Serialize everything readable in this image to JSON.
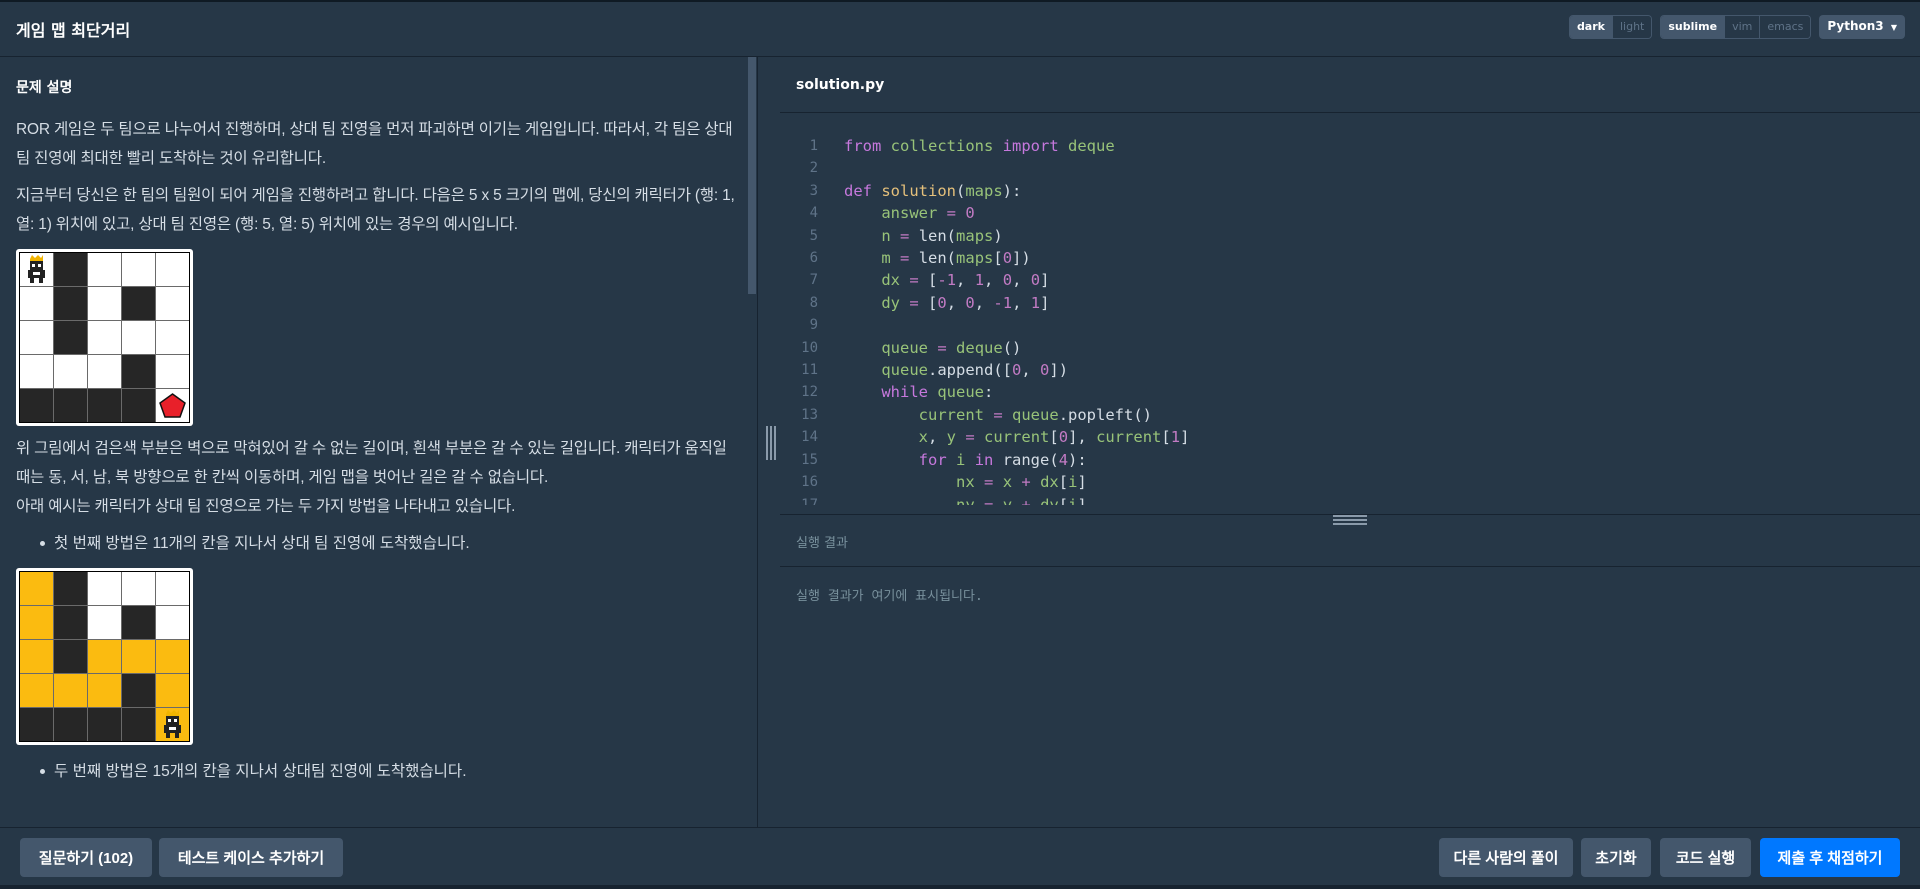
{
  "header": {
    "title": "게임 맵 최단거리",
    "theme_options": [
      "dark",
      "light"
    ],
    "theme_selected": "dark",
    "keymap_options": [
      "sublime",
      "vim",
      "emacs"
    ],
    "keymap_selected": "sublime",
    "language": "Python3"
  },
  "description": {
    "heading": "문제 설명",
    "para1": "ROR 게임은 두 팀으로 나누어서 진행하며, 상대 팀 진영을 먼저 파괴하면 이기는 게임입니다. 따라서, 각 팀은 상대 팀 진영에 최대한 빨리 도착하는 것이 유리합니다.",
    "para2": "지금부터 당신은 한 팀의 팀원이 되어 게임을 진행하려고 합니다. 다음은 5 x 5 크기의 맵에, 당신의 캐릭터가 (행: 1, 열: 1) 위치에 있고, 상대 팀 진영은 (행: 5, 열: 5) 위치에 있는 경우의 예시입니다.",
    "para3": "위 그림에서 검은색 부분은 벽으로 막혀있어 갈 수 없는 길이며, 흰색 부분은 갈 수 있는 길입니다. 캐릭터가 움직일 때는 동, 서, 남, 북 방향으로 한 칸씩 이동하며, 게임 맵을 벗어난 길은 갈 수 없습니다.",
    "para4": "아래 예시는 캐릭터가 상대 팀 진영으로 가는 두 가지 방법을 나타내고 있습니다.",
    "bullet1": "첫 번째 방법은 11개의 칸을 지나서 상대 팀 진영에 도착했습니다.",
    "bullet2": "두 번째 방법은 15개의 칸을 지나서 상대팀 진영에 도착했습니다.",
    "map1": [
      [
        "char",
        "b",
        "w",
        "w",
        "w"
      ],
      [
        "w",
        "b",
        "w",
        "b",
        "w"
      ],
      [
        "w",
        "b",
        "w",
        "w",
        "w"
      ],
      [
        "w",
        "w",
        "w",
        "b",
        "w"
      ],
      [
        "b",
        "b",
        "b",
        "b",
        "goal"
      ]
    ],
    "map2": [
      [
        "y",
        "b",
        "w",
        "w",
        "w"
      ],
      [
        "y",
        "b",
        "w",
        "b",
        "w"
      ],
      [
        "y",
        "b",
        "y",
        "y",
        "y"
      ],
      [
        "y",
        "y",
        "y",
        "b",
        "y"
      ],
      [
        "b",
        "b",
        "b",
        "b",
        "char-y"
      ]
    ]
  },
  "editor": {
    "filename": "solution.py"
  },
  "result": {
    "heading": "실행 결과",
    "placeholder": "실행 결과가 여기에 표시됩니다."
  },
  "footer": {
    "ask_button": "질문하기 (102)",
    "add_testcase_button": "테스트 케이스 추가하기",
    "others_solution_button": "다른 사람의 풀이",
    "reset_button": "초기화",
    "run_button": "코드 실행",
    "submit_button": "제출 후 채점하기"
  },
  "colors": {
    "background": "#263747",
    "primary_button": "#0078ff",
    "secondary_button": "#44576c",
    "path_yellow": "#fbbb10",
    "goal_red": "#e8202a"
  }
}
